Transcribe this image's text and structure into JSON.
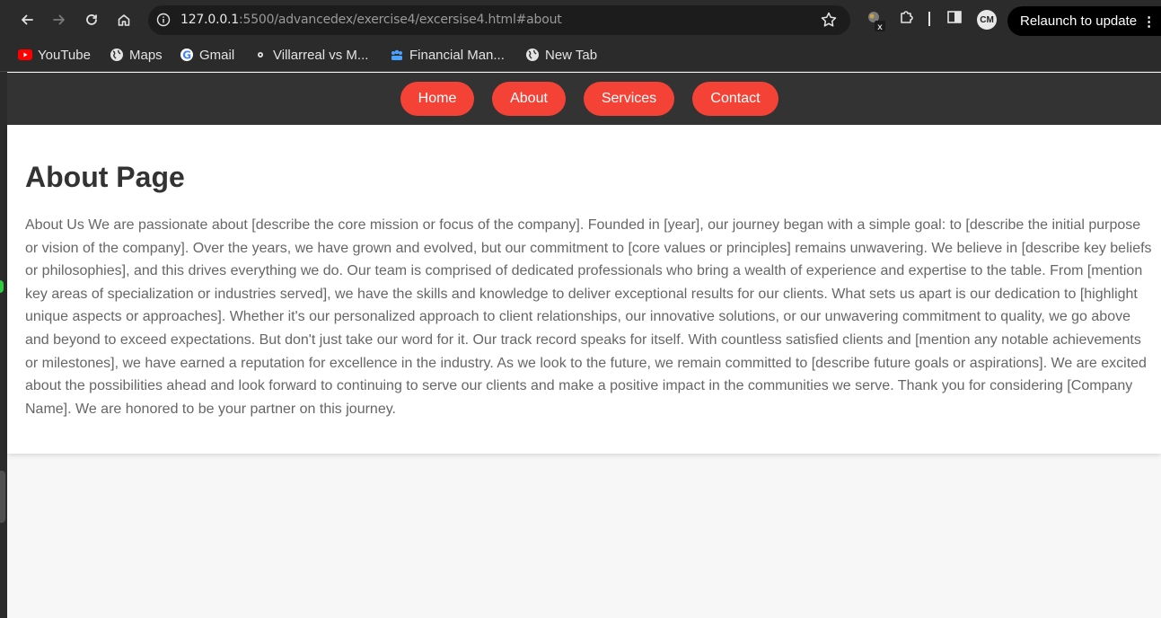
{
  "browser": {
    "url_host": "127.0.0.1",
    "url_rest": ":5500/advancedex/exercise4/excersise4.html#about",
    "relaunch_label": "Relaunch to update",
    "profile_initials": "CM"
  },
  "bookmarks": [
    {
      "label": "YouTube",
      "icon": "youtube-icon"
    },
    {
      "label": "Maps",
      "icon": "globe-icon"
    },
    {
      "label": "Gmail",
      "icon": "google-icon"
    },
    {
      "label": "Villarreal vs M...",
      "icon": "soccer-icon"
    },
    {
      "label": "Financial Man...",
      "icon": "people-icon"
    },
    {
      "label": "New Tab",
      "icon": "globe-icon"
    }
  ],
  "site_nav": {
    "items": [
      "Home",
      "About",
      "Services",
      "Contact"
    ]
  },
  "about": {
    "title": "About Page",
    "body": "About Us We are passionate about [describe the core mission or focus of the company]. Founded in [year], our journey began with a simple goal: to [describe the initial purpose or vision of the company]. Over the years, we have grown and evolved, but our commitment to [core values or principles] remains unwavering. We believe in [describe key beliefs or philosophies], and this drives everything we do. Our team is comprised of dedicated professionals who bring a wealth of experience and expertise to the table. From [mention key areas of specialization or industries served], we have the skills and knowledge to deliver exceptional results for our clients. What sets us apart is our dedication to [highlight unique aspects or approaches]. Whether it's our personalized approach to client relationships, our innovative solutions, or our unwavering commitment to quality, we go above and beyond to exceed expectations. But don't just take our word for it. Our track record speaks for itself. With countless satisfied clients and [mention any notable achievements or milestones], we have earned a reputation for excellence in the industry. As we look to the future, we remain committed to [describe future goals or aspirations]. We are excited about the possibilities ahead and look forward to continuing to serve our clients and make a positive impact in the communities we serve. Thank you for considering [Company Name]. We are honored to be your partner on this journey."
  },
  "colors": {
    "nav_bg": "#333333",
    "button_bg": "#f44336",
    "heading": "#333333",
    "body_text": "#666666"
  }
}
